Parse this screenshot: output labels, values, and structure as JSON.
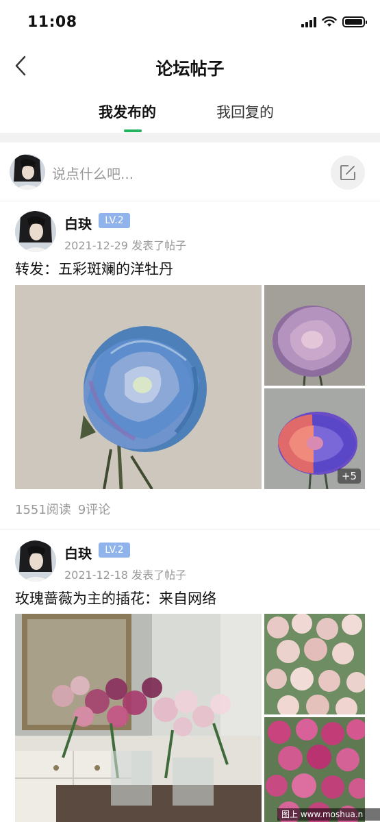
{
  "status_bar": {
    "time": "11:08"
  },
  "nav": {
    "title": "论坛帖子",
    "back_icon": "chevron-left-icon"
  },
  "tabs": [
    {
      "label": "我发布的",
      "active": true
    },
    {
      "label": "我回复的",
      "active": false
    }
  ],
  "composer": {
    "placeholder": "说点什么吧...",
    "edit_icon": "edit-icon"
  },
  "posts": [
    {
      "author": "白玦",
      "level": "LV.2",
      "date_text": "2021-12-29 发表了帖子",
      "title": "转发：五彩斑斓的洋牡丹",
      "more_count": "+5",
      "reads": "1551阅读",
      "comments": "9评论"
    },
    {
      "author": "白玦",
      "level": "LV.2",
      "date_text": "2021-12-18 发表了帖子",
      "title": "玫瑰蔷薇为主的插花：来自网络"
    }
  ],
  "watermark": "图上 www.moshua.n",
  "colors": {
    "accent": "#22b35e",
    "badge": "#8fb3ea",
    "muted": "#999999"
  }
}
